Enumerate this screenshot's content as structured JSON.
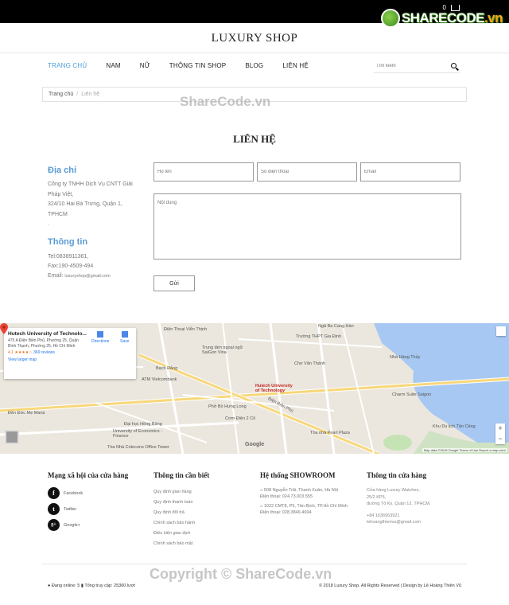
{
  "topbar": {
    "cart_count": "0"
  },
  "sharecode_logo": {
    "brand": "SHARECODE",
    "tld": ".vn"
  },
  "brand": "LUXURY SHOP",
  "nav": [
    {
      "label": "TRANG CHỦ",
      "active": true
    },
    {
      "label": "NAM",
      "active": false
    },
    {
      "label": "NỮ",
      "active": false
    },
    {
      "label": "THÔNG TIN SHOP",
      "active": false
    },
    {
      "label": "BLOG",
      "active": false
    },
    {
      "label": "LIÊN HỆ",
      "active": false
    }
  ],
  "search": {
    "placeholder": "Tìm kiếm"
  },
  "breadcrumb": {
    "home": "Trang chủ",
    "sep": "/",
    "current": "Liên hệ"
  },
  "watermark_top": "ShareCode.vn",
  "page_title": "LIÊN HỆ",
  "address": {
    "heading": "Địa chỉ",
    "company": "Công ty TNHH Dịch Vụ CNTT Giải Pháp Việt,",
    "street": "324/10 Hai Bà Trưng, Quận 1, TPHCM",
    "dot": "."
  },
  "contact": {
    "heading": "Thông tin",
    "tel": "Tel:0838911361,",
    "fax": "Fax:190-4509-494",
    "email_label": "Email:",
    "email": "luxuryshop@gmail.com"
  },
  "form": {
    "name_placeholder": "Họ tên",
    "phone_placeholder": "Số điện thoại",
    "email_placeholder": "Email",
    "message_placeholder": "Nội dung",
    "send_label": "Gửi"
  },
  "map": {
    "place_title": "Hutech University of Technolo...",
    "place_address": "475 A Điện Biên Phủ, Phường 25, Quận Bình Thạnh, Phường 25, Hồ Chí Minh",
    "rating": "4.1 ★★★★☆",
    "reviews": "369 reviews",
    "directions": "Directions",
    "save": "Save",
    "larger_map": "View larger map",
    "pin_label_1": "Hutech University",
    "pin_label_2": "of Technology",
    "labels": {
      "vien_thinh": "Điện Thoại Viễn Thịnh",
      "saigon_vina": "Trung tâm ngoại ngữ SaiGon Vina",
      "vietcombank": "ATM Vietcombank",
      "dien_bien_phu": "Điện Biên Phủ",
      "thpt_gia_dinh": "Trường THPT Gia Định",
      "charm_suite": "Charm Suite Saigon",
      "khu_du_lich": "Khu Du lịch Tân Cảng",
      "nga_ba_cang": "Ngã Ba Cang Hàn",
      "den_duc_me": "Đền Đức Mẹ Maria",
      "uef": "University of Economics - Finance",
      "cotecons": "Tòa Nhà Cotecons Office Tower",
      "pearl_plaza": "Tòa nhà Pearl Plaza",
      "nha_hang_thuy": "Nhà Hàng Thủy",
      "com_dien": "Cơm Điện 2 Cô",
      "bach_dang": "Bạch Đằng",
      "cho_van_thanh": "Chợ Văn Thánh",
      "pho_bo": "Phở Bò Hưng Long",
      "hong_bang": "Đại học Hồng Bàng"
    },
    "google": "Google",
    "attribution": "Map data ©2018 Google   Terms of Use   Report a map error"
  },
  "footer": {
    "social": {
      "heading": "Mạng xã hội của cửa hàng",
      "items": [
        {
          "glyph": "f",
          "label": "Facebook"
        },
        {
          "glyph": "t",
          "label": "Twitter"
        },
        {
          "glyph": "g+",
          "label": "Google+"
        }
      ]
    },
    "info": {
      "heading": "Thông tin cần biết",
      "items": [
        "Quy định giao hàng",
        "Quy định thanh toán",
        "Quy định đổi trả",
        "Chính sách bảo hành",
        "Điều kiện giao dịch",
        "Chính sách bảo mật"
      ]
    },
    "showroom": {
      "heading": "Hệ thống SHOWROOM",
      "s1_addr": "508 Nguyễn Trãi, Thanh Xuân, Hà Nội",
      "s1_phone": "Điện thoại: 024.73.003.555",
      "s2_addr": "1022 CMT8, P5, Tân Bình, TP.Hồ Chí Minh",
      "s2_phone": "Điện thoại: 028.3846.4694"
    },
    "store": {
      "heading": "Thông tin cửa hàng",
      "name": "Cửa hàng Luxury Watches,",
      "addr1": "25/2 KP5,",
      "addr2": "đường Tô Ký, Quận 12, TPHCM.",
      "phone": "+84 1636563921",
      "email": "lehoangthienvu@gmail.com"
    }
  },
  "bottom": {
    "online_label": "Đang online: 5",
    "visits_label": "Tổng truy cập: 25360 lượt",
    "copyright": "© 2018 Luxury Shop. All Rights Reserved | Design by Lê Hoàng Thiên Vũ"
  },
  "watermark_bottom": "Copyright © ShareCode.vn",
  "colors": {
    "accent": "#4aa0d8",
    "heading_blue": "#5b9bd5",
    "topbar": "#000000"
  }
}
